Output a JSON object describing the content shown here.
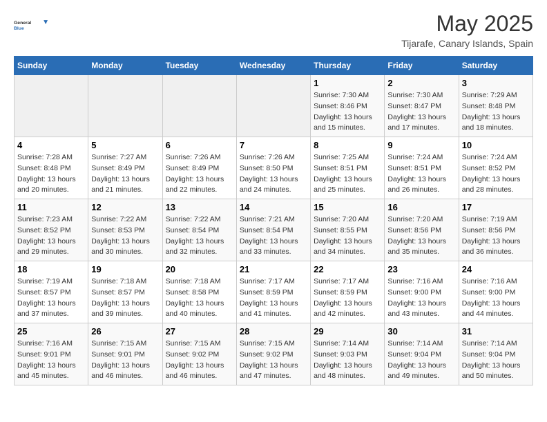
{
  "header": {
    "logo_general": "General",
    "logo_blue": "Blue",
    "month_title": "May 2025",
    "location": "Tijarafe, Canary Islands, Spain"
  },
  "weekdays": [
    "Sunday",
    "Monday",
    "Tuesday",
    "Wednesday",
    "Thursday",
    "Friday",
    "Saturday"
  ],
  "weeks": [
    [
      {
        "day": "",
        "info": ""
      },
      {
        "day": "",
        "info": ""
      },
      {
        "day": "",
        "info": ""
      },
      {
        "day": "",
        "info": ""
      },
      {
        "day": "1",
        "info": "Sunrise: 7:30 AM\nSunset: 8:46 PM\nDaylight: 13 hours and 15 minutes."
      },
      {
        "day": "2",
        "info": "Sunrise: 7:30 AM\nSunset: 8:47 PM\nDaylight: 13 hours and 17 minutes."
      },
      {
        "day": "3",
        "info": "Sunrise: 7:29 AM\nSunset: 8:48 PM\nDaylight: 13 hours and 18 minutes."
      }
    ],
    [
      {
        "day": "4",
        "info": "Sunrise: 7:28 AM\nSunset: 8:48 PM\nDaylight: 13 hours and 20 minutes."
      },
      {
        "day": "5",
        "info": "Sunrise: 7:27 AM\nSunset: 8:49 PM\nDaylight: 13 hours and 21 minutes."
      },
      {
        "day": "6",
        "info": "Sunrise: 7:26 AM\nSunset: 8:49 PM\nDaylight: 13 hours and 22 minutes."
      },
      {
        "day": "7",
        "info": "Sunrise: 7:26 AM\nSunset: 8:50 PM\nDaylight: 13 hours and 24 minutes."
      },
      {
        "day": "8",
        "info": "Sunrise: 7:25 AM\nSunset: 8:51 PM\nDaylight: 13 hours and 25 minutes."
      },
      {
        "day": "9",
        "info": "Sunrise: 7:24 AM\nSunset: 8:51 PM\nDaylight: 13 hours and 26 minutes."
      },
      {
        "day": "10",
        "info": "Sunrise: 7:24 AM\nSunset: 8:52 PM\nDaylight: 13 hours and 28 minutes."
      }
    ],
    [
      {
        "day": "11",
        "info": "Sunrise: 7:23 AM\nSunset: 8:52 PM\nDaylight: 13 hours and 29 minutes."
      },
      {
        "day": "12",
        "info": "Sunrise: 7:22 AM\nSunset: 8:53 PM\nDaylight: 13 hours and 30 minutes."
      },
      {
        "day": "13",
        "info": "Sunrise: 7:22 AM\nSunset: 8:54 PM\nDaylight: 13 hours and 32 minutes."
      },
      {
        "day": "14",
        "info": "Sunrise: 7:21 AM\nSunset: 8:54 PM\nDaylight: 13 hours and 33 minutes."
      },
      {
        "day": "15",
        "info": "Sunrise: 7:20 AM\nSunset: 8:55 PM\nDaylight: 13 hours and 34 minutes."
      },
      {
        "day": "16",
        "info": "Sunrise: 7:20 AM\nSunset: 8:56 PM\nDaylight: 13 hours and 35 minutes."
      },
      {
        "day": "17",
        "info": "Sunrise: 7:19 AM\nSunset: 8:56 PM\nDaylight: 13 hours and 36 minutes."
      }
    ],
    [
      {
        "day": "18",
        "info": "Sunrise: 7:19 AM\nSunset: 8:57 PM\nDaylight: 13 hours and 37 minutes."
      },
      {
        "day": "19",
        "info": "Sunrise: 7:18 AM\nSunset: 8:57 PM\nDaylight: 13 hours and 39 minutes."
      },
      {
        "day": "20",
        "info": "Sunrise: 7:18 AM\nSunset: 8:58 PM\nDaylight: 13 hours and 40 minutes."
      },
      {
        "day": "21",
        "info": "Sunrise: 7:17 AM\nSunset: 8:59 PM\nDaylight: 13 hours and 41 minutes."
      },
      {
        "day": "22",
        "info": "Sunrise: 7:17 AM\nSunset: 8:59 PM\nDaylight: 13 hours and 42 minutes."
      },
      {
        "day": "23",
        "info": "Sunrise: 7:16 AM\nSunset: 9:00 PM\nDaylight: 13 hours and 43 minutes."
      },
      {
        "day": "24",
        "info": "Sunrise: 7:16 AM\nSunset: 9:00 PM\nDaylight: 13 hours and 44 minutes."
      }
    ],
    [
      {
        "day": "25",
        "info": "Sunrise: 7:16 AM\nSunset: 9:01 PM\nDaylight: 13 hours and 45 minutes."
      },
      {
        "day": "26",
        "info": "Sunrise: 7:15 AM\nSunset: 9:01 PM\nDaylight: 13 hours and 46 minutes."
      },
      {
        "day": "27",
        "info": "Sunrise: 7:15 AM\nSunset: 9:02 PM\nDaylight: 13 hours and 46 minutes."
      },
      {
        "day": "28",
        "info": "Sunrise: 7:15 AM\nSunset: 9:02 PM\nDaylight: 13 hours and 47 minutes."
      },
      {
        "day": "29",
        "info": "Sunrise: 7:14 AM\nSunset: 9:03 PM\nDaylight: 13 hours and 48 minutes."
      },
      {
        "day": "30",
        "info": "Sunrise: 7:14 AM\nSunset: 9:04 PM\nDaylight: 13 hours and 49 minutes."
      },
      {
        "day": "31",
        "info": "Sunrise: 7:14 AM\nSunset: 9:04 PM\nDaylight: 13 hours and 50 minutes."
      }
    ]
  ]
}
